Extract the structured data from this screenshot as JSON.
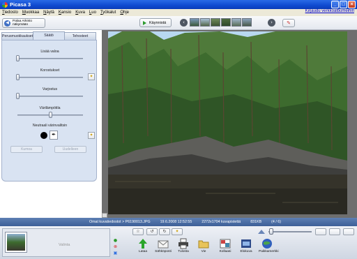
{
  "window": {
    "title": "Picasa 3"
  },
  "menu": {
    "items": [
      "Tiedosto",
      "Muokkaa",
      "Näytä",
      "Kansio",
      "Kuva",
      "Luo",
      "Työkalut",
      "Ohje"
    ],
    "upload_link": "Kirjaudu verkkoalbumeihin"
  },
  "toolbar": {
    "back_label_line1": "Palaa Arkisto",
    "back_label_line2": "näkymään",
    "slideshow_label": "Käynnistä"
  },
  "edit_tabs": [
    "Perusmuokkaukset",
    "Säätö",
    "Tehosteet"
  ],
  "active_tab": "Säätö",
  "adjust": {
    "sliders": [
      {
        "label": "Lisää valoa",
        "value": 0.0
      },
      {
        "label": "Korostukset",
        "value": 0.0
      },
      {
        "label": "Varjostus",
        "value": 0.0
      },
      {
        "label": "Värilämpötila",
        "value": 0.5
      }
    ],
    "neutral_label": "Neutraali värinvalitsin",
    "neutral_color": "#000000",
    "undo_label": "Kumoa",
    "redo_label": "Uudelleen"
  },
  "status": {
    "folder": "Omat kuvatiedostot > P6190013.JPG",
    "date": "19.6.2008 12:52:55",
    "dimensions": "2272x1704 kuvapistettä",
    "size": "831KB",
    "position": "(4 / 6)"
  },
  "tray": {
    "selection_label": "Valinta"
  },
  "actions": [
    {
      "label": "Lataa",
      "icon": "upload-icon"
    },
    {
      "label": "Sähköposti",
      "icon": "email-icon"
    },
    {
      "label": "Tulosta",
      "icon": "print-icon"
    },
    {
      "label": "Vie",
      "icon": "export-folder-icon"
    },
    {
      "label": "Kollaasi",
      "icon": "collage-icon"
    },
    {
      "label": "Elokuva",
      "icon": "movie-icon"
    },
    {
      "label": "Paikkamerkki",
      "icon": "geotag-icon"
    }
  ],
  "colors": {
    "titlebar": "#0f4ad0",
    "statusbar": "#4a6ea6",
    "panel": "#d9e3f2"
  }
}
